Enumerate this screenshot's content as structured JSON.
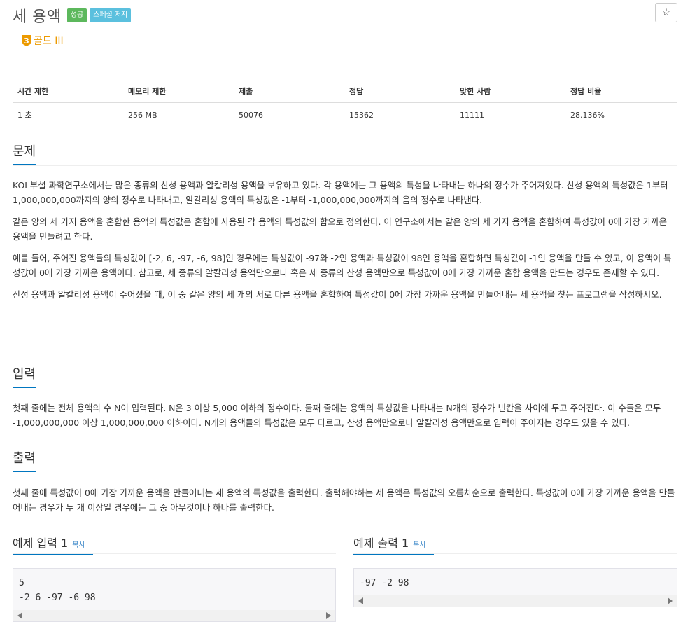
{
  "title": "세 용액",
  "badges": {
    "success": "성공",
    "special": "스페셜 저지"
  },
  "star_icon": "☆",
  "tier": {
    "level": "3",
    "label": "골드 III"
  },
  "stats": {
    "headers": [
      "시간 제한",
      "메모리 제한",
      "제출",
      "정답",
      "맞힌 사람",
      "정답 비율"
    ],
    "values": [
      "1 초",
      "256 MB",
      "50076",
      "15362",
      "11111",
      "28.136%"
    ]
  },
  "sections": {
    "problem": {
      "title": "문제",
      "paragraphs": [
        "KOI 부설 과학연구소에서는 많은 종류의 산성 용액과 알칼리성 용액을 보유하고 있다. 각 용액에는 그 용액의 특성을 나타내는 하나의 정수가 주어져있다.  산성 용액의 특성값은 1부터 1,000,000,000까지의 양의 정수로 나타내고, 알칼리성 용액의 특성값은 -1부터 -1,000,000,000까지의 음의 정수로 나타낸다.",
        "같은 양의 세 가지 용액을 혼합한 용액의 특성값은 혼합에 사용된 각 용액의 특성값의 합으로 정의한다. 이 연구소에서는 같은 양의 세 가지 용액을 혼합하여 특성값이 0에 가장 가까운 용액을 만들려고 한다.",
        "예를 들어, 주어진 용액들의 특성값이 [-2, 6, -97, -6, 98]인 경우에는 특성값이 -97와 -2인 용액과 특성값이 98인 용액을 혼합하면 특성값이 -1인 용액을 만들 수 있고, 이 용액이 특성값이 0에 가장 가까운 용액이다. 참고로, 세 종류의 알칼리성 용액만으로나 혹은 세 종류의 산성 용액만으로 특성값이 0에 가장 가까운 혼합 용액을 만드는 경우도 존재할 수 있다.",
        "산성 용액과 알칼리성 용액이 주어졌을 때, 이 중 같은 양의 세 개의 서로 다른 용액을 혼합하여 특성값이 0에 가장 가까운 용액을 만들어내는 세 용액을 찾는 프로그램을 작성하시오."
      ]
    },
    "input": {
      "title": "입력",
      "paragraph": "첫째 줄에는 전체 용액의 수 N이 입력된다. N은 3 이상 5,000 이하의 정수이다. 둘째 줄에는 용액의 특성값을 나타내는 N개의 정수가 빈칸을 사이에 두고 주어진다. 이 수들은 모두 -1,000,000,000 이상 1,000,000,000 이하이다. N개의 용액들의 특성값은 모두 다르고, 산성 용액만으로나 알칼리성 용액만으로 입력이 주어지는 경우도 있을 수 있다."
    },
    "output": {
      "title": "출력",
      "paragraph": "첫째 줄에 특성값이 0에 가장 가까운 용액을 만들어내는 세 용액의 특성값을 출력한다. 출력해야하는 세 용액은 특성값의 오름차순으로 출력한다. 특성값이 0에 가장 가까운 용액을 만들어내는 경우가 두 개 이상일 경우에는 그 중 아무것이나 하나를 출력한다."
    }
  },
  "examples": {
    "input": {
      "title": "예제 입력 1",
      "copy": "복사",
      "content": "5\n-2 6 -97 -6 98"
    },
    "output": {
      "title": "예제 출력 1",
      "copy": "복사",
      "content": "-97 -2 98"
    }
  }
}
